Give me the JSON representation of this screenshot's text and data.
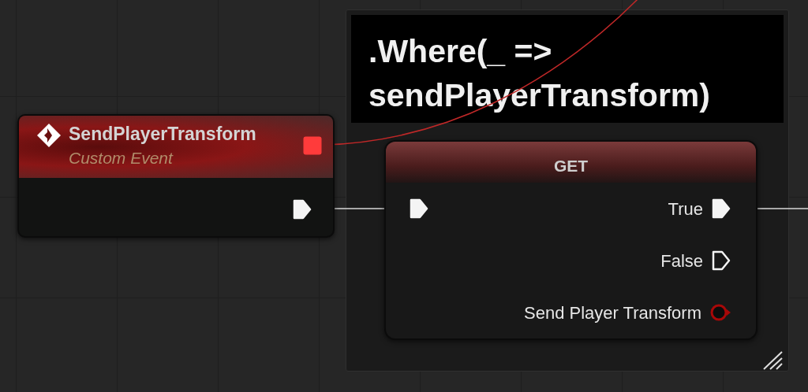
{
  "comment": {
    "title": ".Where(_ => sendPlayerTransform)"
  },
  "event_node": {
    "title": "SendPlayerTransform",
    "subtitle": "Custom Event",
    "pins": [
      {
        "kind": "delegate",
        "connected": true
      },
      {
        "kind": "exec",
        "connected": true
      }
    ]
  },
  "get_node": {
    "title": "GET",
    "inputs": [
      {
        "kind": "exec",
        "connected": true
      }
    ],
    "outputs": [
      {
        "kind": "exec",
        "label": "True",
        "connected": true
      },
      {
        "kind": "exec",
        "label": "False",
        "connected": false
      },
      {
        "kind": "object",
        "label": "Send Player Transform",
        "connected": false
      }
    ]
  }
}
